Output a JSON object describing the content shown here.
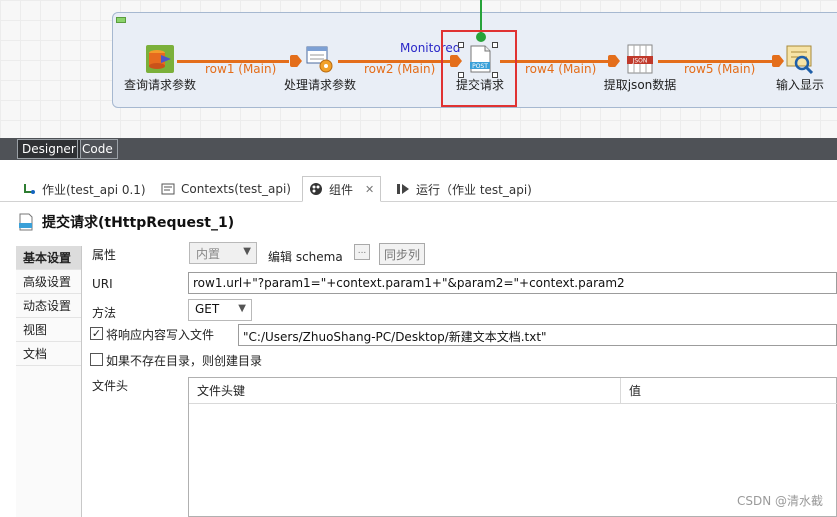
{
  "canvas": {
    "nodes": [
      {
        "label": "查询请求参数",
        "icon": "database-input-icon"
      },
      {
        "label": "处理请求参数",
        "icon": "map-gear-icon"
      },
      {
        "label": "提交请求",
        "icon": "post-document-icon"
      },
      {
        "label": "提取json数据",
        "icon": "json-extract-icon"
      },
      {
        "label": "输入显示",
        "icon": "log-display-icon"
      }
    ],
    "connections": [
      "row1 (Main)",
      "row2 (Main)",
      "row4 (Main)",
      "row5 (Main)"
    ],
    "monitored_label": "Monitored",
    "colors": {
      "connection": "#e46e1b",
      "selection": "#e03232",
      "trigger": "#27a33a"
    }
  },
  "editor_tabs": {
    "designer": "Designer",
    "code": "Code"
  },
  "view_tabs": [
    {
      "label": "作业(test_api 0.1)",
      "icon": "job-icon"
    },
    {
      "label": "Contexts(test_api)",
      "icon": "contexts-icon"
    },
    {
      "label": "组件",
      "icon": "component-palette-icon"
    },
    {
      "label": "运行（作业 test_api)",
      "icon": "run-icon"
    }
  ],
  "component": {
    "title": "提交请求(tHttpRequest_1)"
  },
  "left_nav": [
    "基本设置",
    "高级设置",
    "动态设置",
    "视图",
    "文档"
  ],
  "settings": {
    "property_label": "属性",
    "property_value": "内置",
    "edit_schema_label": "编辑 schema",
    "schema_button": "...",
    "sync_columns_button": "同步列",
    "uri_label": "URI",
    "uri_value": "row1.url+\"?param1=\"+context.param1+\"&param2=\"+context.param2",
    "method_label": "方法",
    "method_value": "GET",
    "write_response_label": "将响应内容写入文件",
    "write_response_checked": "✓",
    "file_path": "\"C:/Users/ZhuoShang-PC/Desktop/新建文本文档.txt\"",
    "create_dir_label": "如果不存在目录，则创建目录",
    "headers_label": "文件头",
    "headers_columns": [
      "文件头键",
      "值"
    ]
  },
  "watermark": "CSDN @清水截"
}
